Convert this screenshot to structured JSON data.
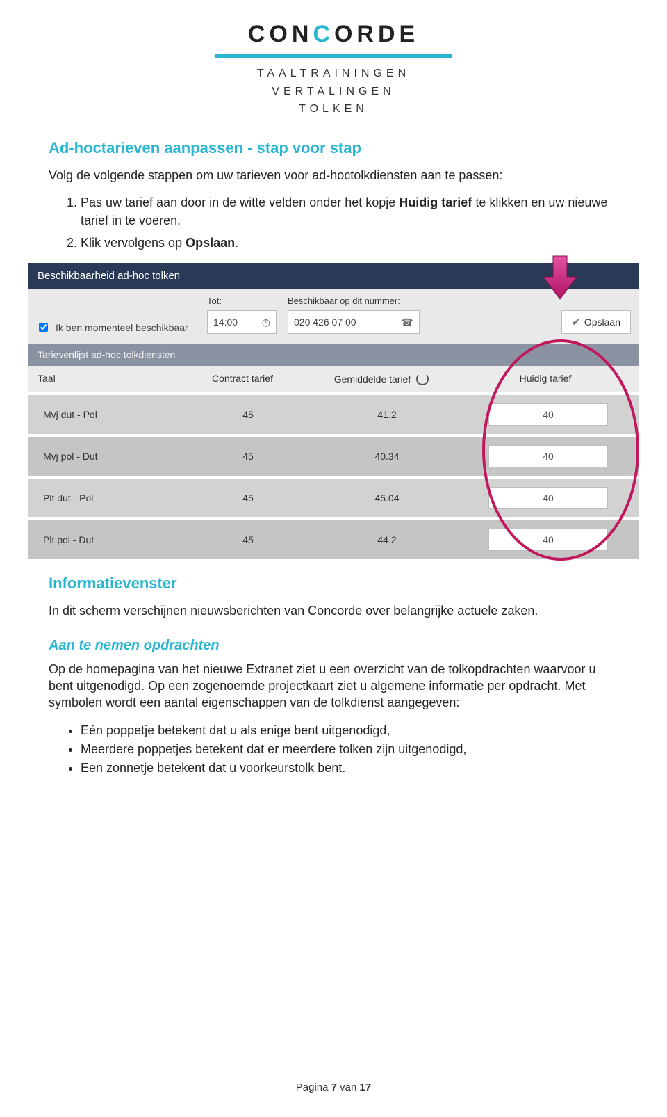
{
  "logo": {
    "brand_pre": "CON",
    "brand_c": "C",
    "brand_post": "ORDE",
    "sub1": "TAALTRAININGEN",
    "sub2": "VERTALINGEN",
    "sub3": "TOLKEN"
  },
  "section1": {
    "title": "Ad-hoctarieven aanpassen - stap voor stap",
    "intro": "Volg de volgende stappen om uw tarieven voor ad-hoctolkdiensten aan te passen:",
    "step1_pre": "Pas uw tarief aan door in de witte velden onder het kopje ",
    "step1_bold": "Huidig tarief",
    "step1_post": " te klikken en uw nieuwe tarief in te voeren.",
    "step2_pre": "Klik vervolgens op ",
    "step2_bold": "Opslaan",
    "step2_post": "."
  },
  "panel": {
    "bar1": "Beschikbaarheid ad-hoc tolken",
    "check_label": "Ik ben momenteel beschikbaar",
    "tot_label": "Tot:",
    "tot_value": "14:00",
    "num_label": "Beschikbaar op dit nummer:",
    "num_value": "020 426 07 00",
    "save_label": "Opslaan",
    "bar2": "Tarievenlijst ad-hoc tolkdiensten",
    "col_taal": "Taal",
    "col_contract": "Contract tarief",
    "col_gemiddelde": "Gemiddelde tarief",
    "col_huidig": "Huidig tarief",
    "rows": [
      {
        "taal": "Mvj dut - Pol",
        "contract": "45",
        "gem": "41.2",
        "huidig": "40"
      },
      {
        "taal": "Mvj pol - Dut",
        "contract": "45",
        "gem": "40.34",
        "huidig": "40"
      },
      {
        "taal": "Plt dut - Pol",
        "contract": "45",
        "gem": "45.04",
        "huidig": "40"
      },
      {
        "taal": "Plt pol - Dut",
        "contract": "45",
        "gem": "44.2",
        "huidig": "40"
      }
    ]
  },
  "section2": {
    "title": "Informatievenster",
    "body": "In dit scherm verschijnen nieuwsberichten van Concorde over belangrijke actuele zaken."
  },
  "section3": {
    "title": "Aan te nemen opdrachten",
    "body": "Op de homepagina van het nieuwe Extranet ziet u een overzicht van de tolkopdrachten waarvoor u bent uitgenodigd. Op een zogenoemde projectkaart ziet u algemene informatie per opdracht. Met symbolen wordt een aantal eigenschappen van de tolkdienst aangegeven:",
    "b1": "Eén poppetje betekent dat u als enige bent uitgenodigd,",
    "b2": "Meerdere poppetjes betekent dat er meerdere tolken zijn uitgenodigd,",
    "b3": "Een zonnetje betekent dat u voorkeurstolk bent."
  },
  "footer": {
    "pre": "Pagina ",
    "num": "7",
    "post": " van ",
    "total": "17"
  }
}
